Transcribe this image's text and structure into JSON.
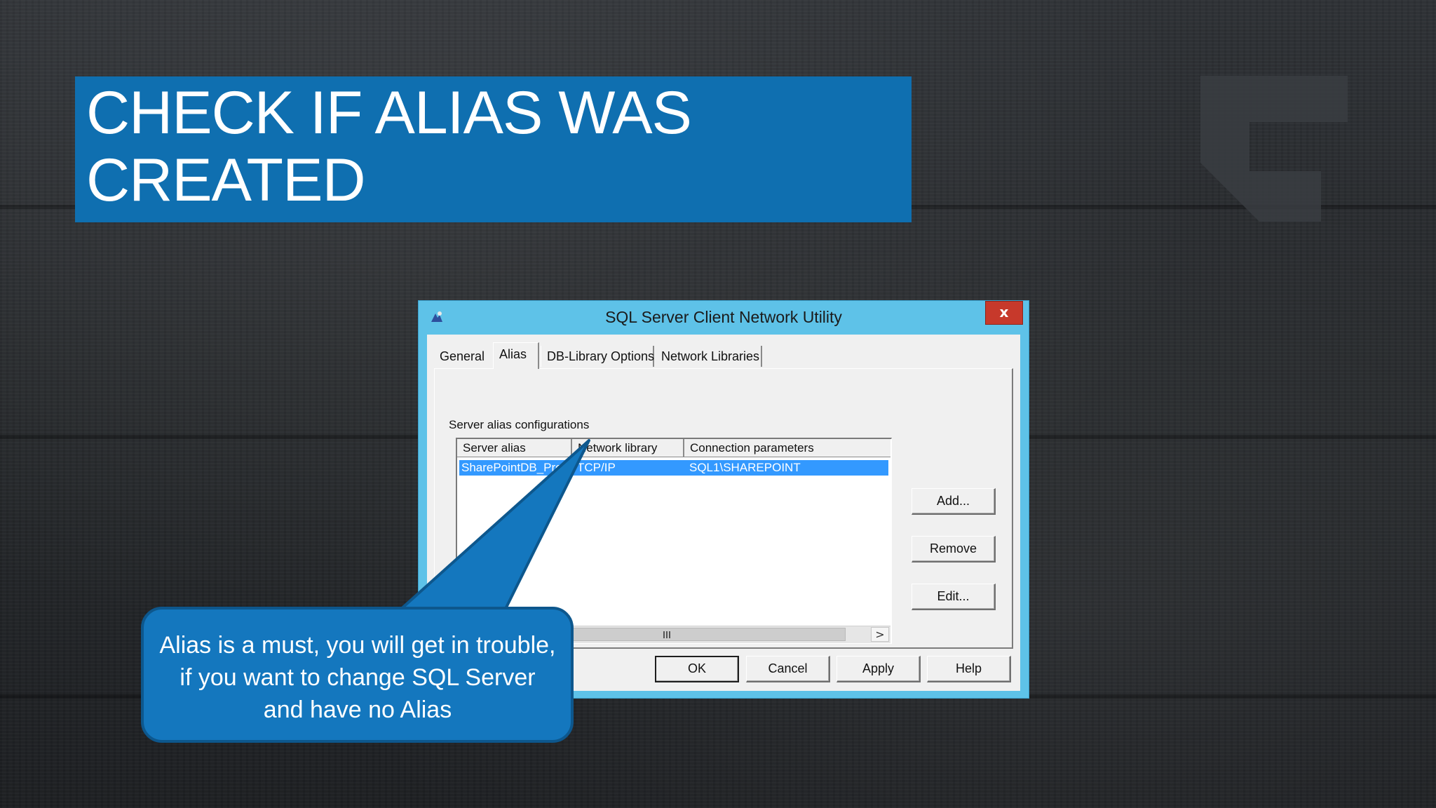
{
  "slide": {
    "title": "CHECK IF ALIAS WAS CREATED"
  },
  "dialog": {
    "title": "SQL Server Client Network Utility",
    "close_label": "x",
    "tabs": [
      {
        "label": "General"
      },
      {
        "label": "Alias"
      },
      {
        "label": "DB-Library Options"
      },
      {
        "label": "Network Libraries"
      }
    ],
    "active_tab": "Alias",
    "group_label": "Server alias configurations",
    "list": {
      "columns": [
        "Server alias",
        "Network library",
        "Connection parameters"
      ],
      "rows": [
        {
          "alias": "SharePointDB_Prod",
          "library": "TCP/IP",
          "params": "SQL1\\SHAREPOINT",
          "selected": true
        }
      ],
      "scroll_right_label": ">"
    },
    "side_buttons": {
      "add": "Add...",
      "remove": "Remove",
      "edit": "Edit..."
    },
    "footer_buttons": {
      "ok": "OK",
      "cancel": "Cancel",
      "apply": "Apply",
      "help": "Help"
    }
  },
  "callout": {
    "text": "Alias is a must, you will get in trouble, if you want to change SQL Server and have no Alias"
  },
  "colors": {
    "banner": "#0f6fb0",
    "dialog_frame": "#5ec2e8",
    "selection": "#3399ff",
    "close_button": "#c7392b",
    "callout": "#1477be"
  }
}
